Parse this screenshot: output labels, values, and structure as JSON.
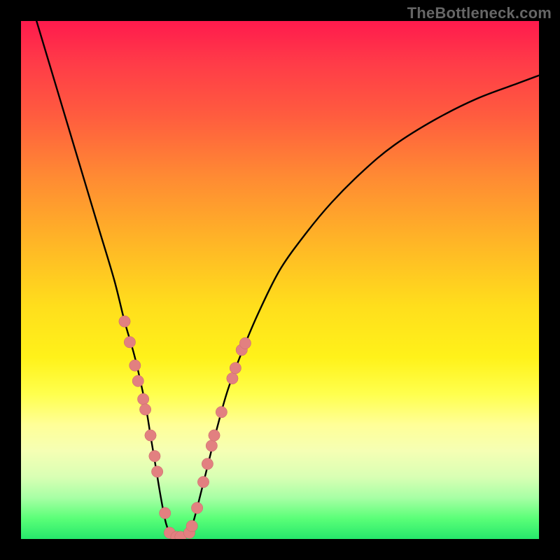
{
  "watermark": "TheBottleneck.com",
  "colors": {
    "background": "#000000",
    "curve": "#000000",
    "marker_fill": "#e28080",
    "marker_stroke": "#c86a6a"
  },
  "chart_data": {
    "type": "line",
    "title": "",
    "xlabel": "",
    "ylabel": "",
    "xlim": [
      0,
      100
    ],
    "ylim": [
      0,
      100
    ],
    "series": [
      {
        "name": "curve",
        "x": [
          3,
          6,
          9,
          12,
          15,
          18,
          20,
          22,
          24,
          25,
          26,
          27,
          28,
          29,
          30,
          31,
          32,
          33,
          34,
          36,
          38,
          40,
          43,
          46,
          50,
          55,
          60,
          66,
          72,
          80,
          88,
          96,
          100
        ],
        "y": [
          100,
          90,
          80,
          70,
          60,
          50,
          42,
          35,
          26,
          20,
          14,
          8,
          3,
          0.8,
          0.3,
          0.3,
          0.8,
          2.5,
          6,
          14,
          22,
          29,
          37,
          44,
          52,
          59,
          65,
          71,
          76,
          81,
          85,
          88,
          89.5
        ]
      }
    ],
    "markers": [
      {
        "x": 20,
        "y": 42
      },
      {
        "x": 21,
        "y": 38
      },
      {
        "x": 22,
        "y": 33.5
      },
      {
        "x": 22.6,
        "y": 30.5
      },
      {
        "x": 23.6,
        "y": 27
      },
      {
        "x": 24,
        "y": 25
      },
      {
        "x": 25,
        "y": 20
      },
      {
        "x": 25.8,
        "y": 16
      },
      {
        "x": 26.3,
        "y": 13
      },
      {
        "x": 27.8,
        "y": 5
      },
      {
        "x": 28.7,
        "y": 1.2
      },
      {
        "x": 30,
        "y": 0.4
      },
      {
        "x": 30.8,
        "y": 0.4
      },
      {
        "x": 32.5,
        "y": 1.2
      },
      {
        "x": 33,
        "y": 2.5
      },
      {
        "x": 34,
        "y": 6
      },
      {
        "x": 35.2,
        "y": 11
      },
      {
        "x": 36,
        "y": 14.5
      },
      {
        "x": 36.8,
        "y": 18
      },
      {
        "x": 37.3,
        "y": 20
      },
      {
        "x": 38.7,
        "y": 24.5
      },
      {
        "x": 40.8,
        "y": 31
      },
      {
        "x": 41.4,
        "y": 33
      },
      {
        "x": 42.6,
        "y": 36.5
      },
      {
        "x": 43.3,
        "y": 37.8
      }
    ]
  }
}
